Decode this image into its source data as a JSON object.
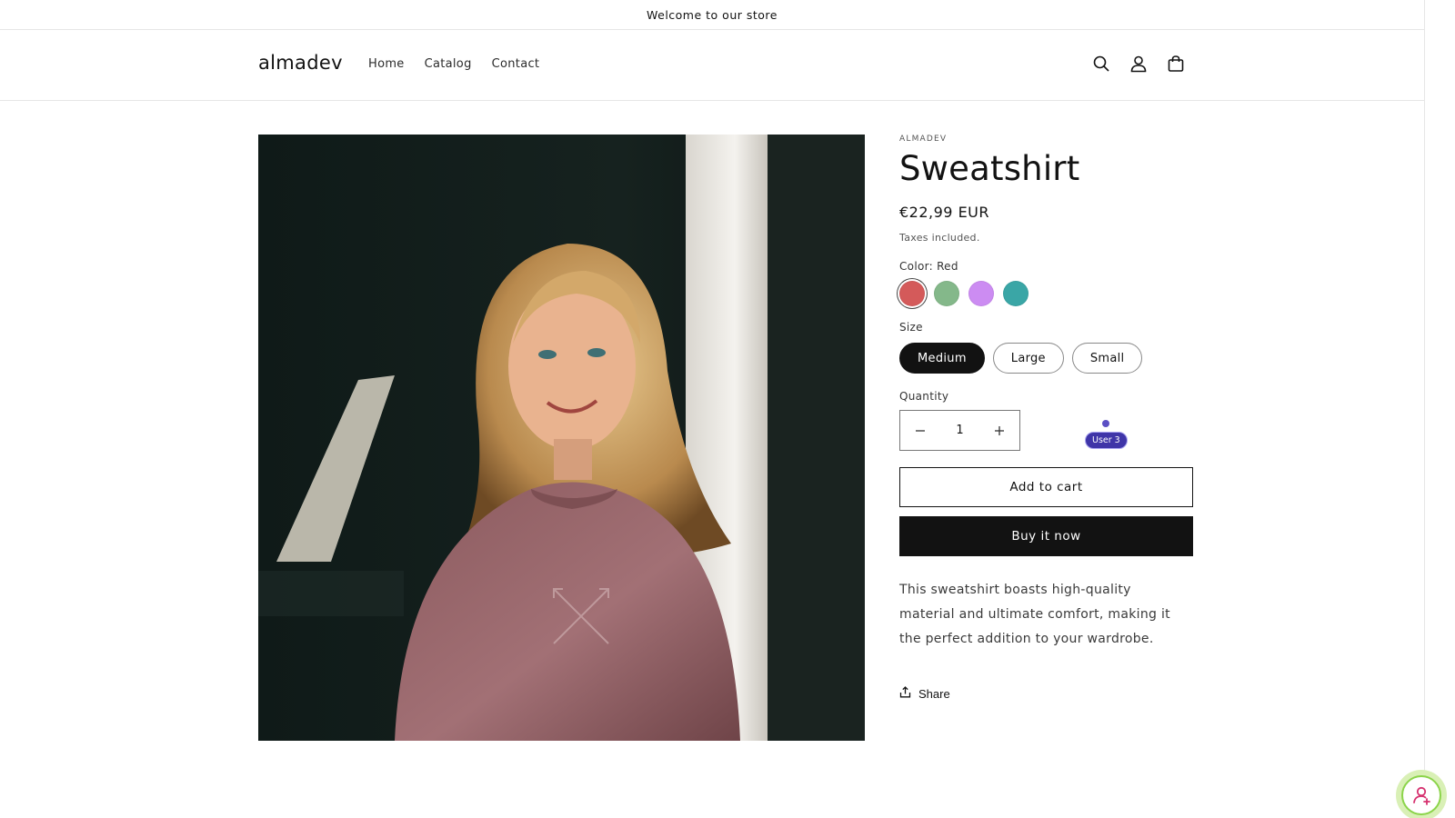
{
  "announcement": {
    "text": "Welcome to our store"
  },
  "header": {
    "logo": "almadev",
    "nav": [
      "Home",
      "Catalog",
      "Contact"
    ],
    "icons": [
      "search-icon",
      "account-icon",
      "cart-icon"
    ]
  },
  "product": {
    "vendor": "ALMADEV",
    "title": "Sweatshirt",
    "price": "€22,99 EUR",
    "tax_note": "Taxes included.",
    "color_label": "Color: Red",
    "swatches": [
      {
        "name": "Red",
        "hex": "#d45a5a",
        "selected": true
      },
      {
        "name": "Green",
        "hex": "#84b88a",
        "selected": false
      },
      {
        "name": "Purple",
        "hex": "#cc8cf2",
        "selected": false
      },
      {
        "name": "Teal",
        "hex": "#3aa6a6",
        "selected": false
      }
    ],
    "size_label": "Size",
    "sizes": [
      {
        "label": "Medium",
        "selected": true
      },
      {
        "label": "Large",
        "selected": false
      },
      {
        "label": "Small",
        "selected": false
      }
    ],
    "quantity_label": "Quantity",
    "quantity": "1",
    "add_to_cart": "Add to cart",
    "buy_now": "Buy it now",
    "description": "This sweatshirt boasts high-quality material and ultimate comfort, making it the perfect addition to your wardrobe.",
    "share": "Share"
  },
  "collab_cursor": {
    "label": "User 3",
    "color": "#3f35a8"
  },
  "colors": {
    "accent": "#121212",
    "fab_ring": "#8bd44a"
  }
}
